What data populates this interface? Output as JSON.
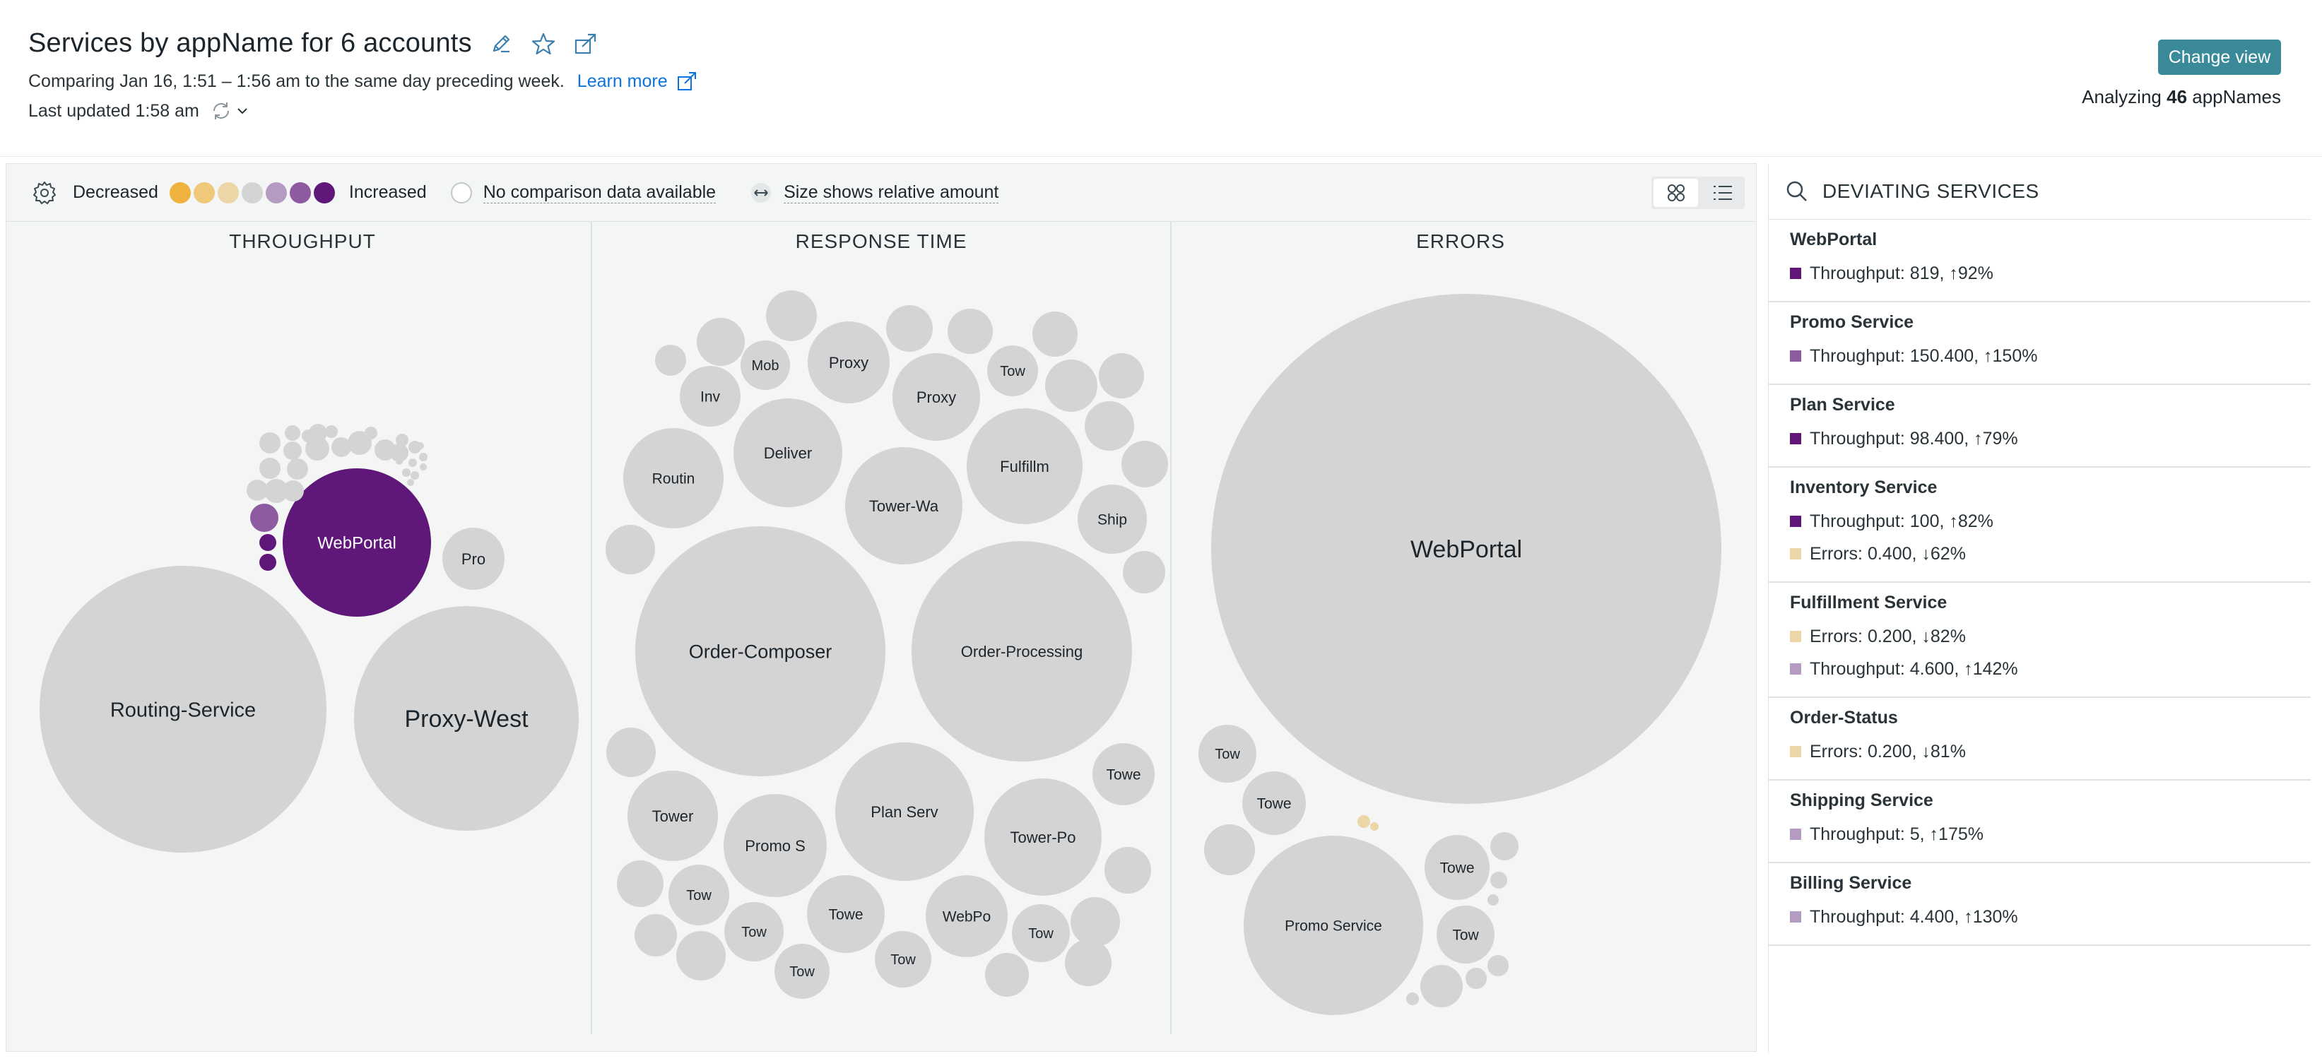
{
  "header": {
    "title": "Services by appName for 6 accounts",
    "comparison_text": "Comparing Jan 16, 1:51 – 1:56 am to the same day preceding week.",
    "learn_more": "Learn more",
    "last_updated": "Last updated 1:58 am",
    "change_view": "Change view",
    "analyzing_prefix": "Analyzing",
    "analyzing_count": "46",
    "analyzing_suffix": "appNames",
    "icons": [
      "pencil-icon",
      "star-icon",
      "share-icon",
      "refresh-icon",
      "chevron-down-icon"
    ]
  },
  "legend": {
    "decreased": "Decreased",
    "increased": "Increased",
    "no_data": "No comparison data available",
    "size_note": "Size shows relative amount",
    "scale_colors": [
      "#f0b23f",
      "#f0c87a",
      "#ecd6a8",
      "#d4d4d4",
      "#b39bc2",
      "#8e5aa0",
      "#5f177a"
    ]
  },
  "columns": [
    "THROUGHPUT",
    "RESPONSE TIME",
    "ERRORS"
  ],
  "colors": {
    "neutral": "#d4d4d4",
    "increase_strong": "#5f177a",
    "increase_mid": "#8e5aa0",
    "increase_light": "#b39bc2",
    "decrease_light": "#ecd6a8",
    "accent": "#3a8a9a",
    "link": "#0c74df"
  },
  "bubbles": {
    "throughput": [
      {
        "label": "WebPortal",
        "tone": "increase_strong"
      },
      {
        "label": "Pro",
        "tone": "neutral"
      },
      {
        "label": "Routing-Service",
        "tone": "neutral"
      },
      {
        "label": "Proxy-West",
        "tone": "neutral"
      }
    ],
    "response_time": [
      {
        "label": "Mob"
      },
      {
        "label": "Proxy"
      },
      {
        "label": "Inv"
      },
      {
        "label": "Proxy"
      },
      {
        "label": "Tow"
      },
      {
        "label": "Deliver"
      },
      {
        "label": "Routin"
      },
      {
        "label": "Fulfillm"
      },
      {
        "label": "Tower-Wa"
      },
      {
        "label": "Ship"
      },
      {
        "label": "Order-Composer"
      },
      {
        "label": "Order-Processing"
      },
      {
        "label": "Towe"
      },
      {
        "label": "Tower"
      },
      {
        "label": "Plan Serv"
      },
      {
        "label": "Promo S"
      },
      {
        "label": "Tower-Po"
      },
      {
        "label": "Tow"
      },
      {
        "label": "Towe"
      },
      {
        "label": "WebPo"
      },
      {
        "label": "Tow"
      },
      {
        "label": "Tow"
      },
      {
        "label": "Tow"
      },
      {
        "label": "Tow"
      }
    ],
    "errors": [
      {
        "label": "WebPortal"
      },
      {
        "label": "Tow"
      },
      {
        "label": "Towe"
      },
      {
        "label": "Promo Service"
      },
      {
        "label": "Towe"
      },
      {
        "label": "Tow"
      }
    ]
  },
  "side_panel": {
    "title": "DEVIATING SERVICES",
    "services": [
      {
        "name": "WebPortal",
        "metrics": [
          {
            "text": "Throughput: 819, ↑92%",
            "color": "#5f177a"
          }
        ]
      },
      {
        "name": "Promo Service",
        "metrics": [
          {
            "text": "Throughput: 150.400, ↑150%",
            "color": "#8e5aa0"
          }
        ]
      },
      {
        "name": "Plan Service",
        "metrics": [
          {
            "text": "Throughput: 98.400, ↑79%",
            "color": "#5f177a"
          }
        ]
      },
      {
        "name": "Inventory Service",
        "metrics": [
          {
            "text": "Throughput: 100, ↑82%",
            "color": "#5f177a"
          },
          {
            "text": "Errors: 0.400, ↓62%",
            "color": "#ecd6a8"
          }
        ]
      },
      {
        "name": "Fulfillment Service",
        "metrics": [
          {
            "text": "Errors: 0.200, ↓82%",
            "color": "#ecd6a8"
          },
          {
            "text": "Throughput: 4.600, ↑142%",
            "color": "#b39bc2"
          }
        ]
      },
      {
        "name": "Order-Status",
        "metrics": [
          {
            "text": "Errors: 0.200, ↓81%",
            "color": "#ecd6a8"
          }
        ]
      },
      {
        "name": "Shipping Service",
        "metrics": [
          {
            "text": "Throughput: 5, ↑175%",
            "color": "#b39bc2"
          }
        ]
      },
      {
        "name": "Billing Service",
        "metrics": [
          {
            "text": "Throughput: 4.400, ↑130%",
            "color": "#b39bc2"
          }
        ]
      }
    ]
  }
}
